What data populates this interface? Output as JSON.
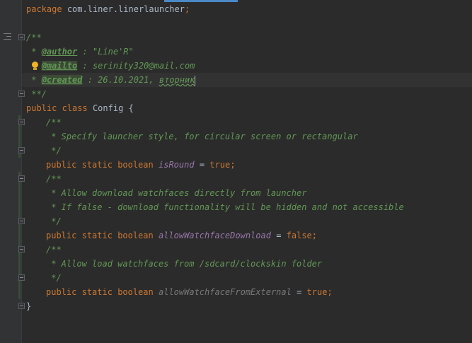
{
  "code": {
    "package_kw": "package",
    "package_name": "com.liner.linerlauncher",
    "semicolon": ";",
    "header_doc": {
      "open": "/**",
      "author_prefix": " * ",
      "author_tag": "@author",
      "author_value": " : \"Line'R\"",
      "mailto_prefix": " * ",
      "mailto_tag": "@mailto",
      "mailto_value": " : serinity320@mail.com",
      "created_prefix": " * ",
      "created_tag": "@created",
      "created_value": " : 26.10.2021, ",
      "created_weekday": "вторник",
      "close": " **/"
    },
    "class_decl": {
      "public": "public",
      "class": "class",
      "name": "Config",
      "open_brace": "{",
      "close_brace": "}"
    },
    "modifiers": {
      "public": "public",
      "static": "static",
      "boolean": "boolean",
      "equals": "=",
      "semicolon": ";"
    },
    "field1": {
      "doc_open": "/**",
      "doc_line1": " * Specify launcher style, for circular screen or rectangular",
      "doc_close": " */",
      "name": "isRound",
      "value": "true"
    },
    "field2": {
      "doc_open": "/**",
      "doc_line1": " * Allow download watchfaces directly from launcher",
      "doc_line2": " * If false - download functionality will be hidden and not accessible",
      "doc_close": " */",
      "name": "allowWatchfaceDownload",
      "value": "false"
    },
    "field3": {
      "doc_open": "/**",
      "doc_line1": " * Allow load watchfaces from /sdcard/clockskin folder",
      "doc_close": " */",
      "name": "allowWatchfaceFromExternal",
      "value": "true"
    }
  },
  "gutter": {
    "icons": [
      "structure-icon",
      "lightbulb-icon",
      "fold-icon"
    ]
  },
  "colors": {
    "background": "#2b2b2b",
    "keyword": "#cc7832",
    "doc_comment": "#629755",
    "field": "#9876aa",
    "unused_field": "#787878",
    "text": "#a9b7c6"
  }
}
